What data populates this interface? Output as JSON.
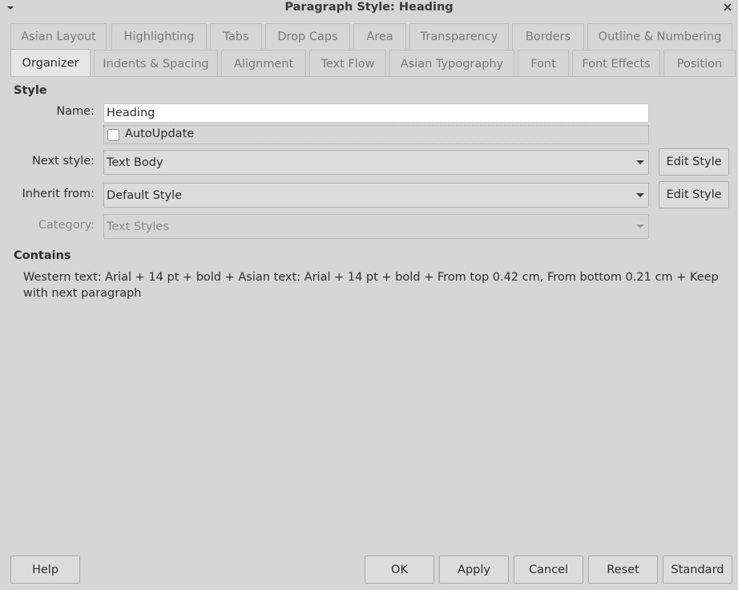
{
  "window": {
    "title": "Paragraph Style: Heading"
  },
  "tabs_row1": [
    "Asian Layout",
    "Highlighting",
    "Tabs",
    "Drop Caps",
    "Area",
    "Transparency",
    "Borders",
    "Outline & Numbering"
  ],
  "tabs_row2": [
    "Organizer",
    "Indents & Spacing",
    "Alignment",
    "Text Flow",
    "Asian Typography",
    "Font",
    "Font Effects",
    "Position"
  ],
  "active_tab": "Organizer",
  "style_section": {
    "heading": "Style",
    "name_label": "Name:",
    "name_value": "Heading",
    "autoupdate_label": "AutoUpdate",
    "autoupdate_checked": false,
    "next_style_label": "Next style:",
    "next_style_value": "Text Body",
    "inherit_label": "Inherit from:",
    "inherit_value": "Default Style",
    "category_label": "Category:",
    "category_value": "Text Styles",
    "edit_style_label": "Edit Style"
  },
  "contains": {
    "heading": "Contains",
    "text": "Western text: Arial + 14 pt + bold + Asian text: Arial + 14 pt + bold + From top 0.42 cm, From bottom 0.21 cm + Keep with next paragraph"
  },
  "buttons": {
    "help": "Help",
    "ok": "OK",
    "apply": "Apply",
    "cancel": "Cancel",
    "reset": "Reset",
    "standard": "Standard"
  },
  "icons": {
    "window_menu": "chevron-down-icon",
    "close": "close-icon"
  }
}
